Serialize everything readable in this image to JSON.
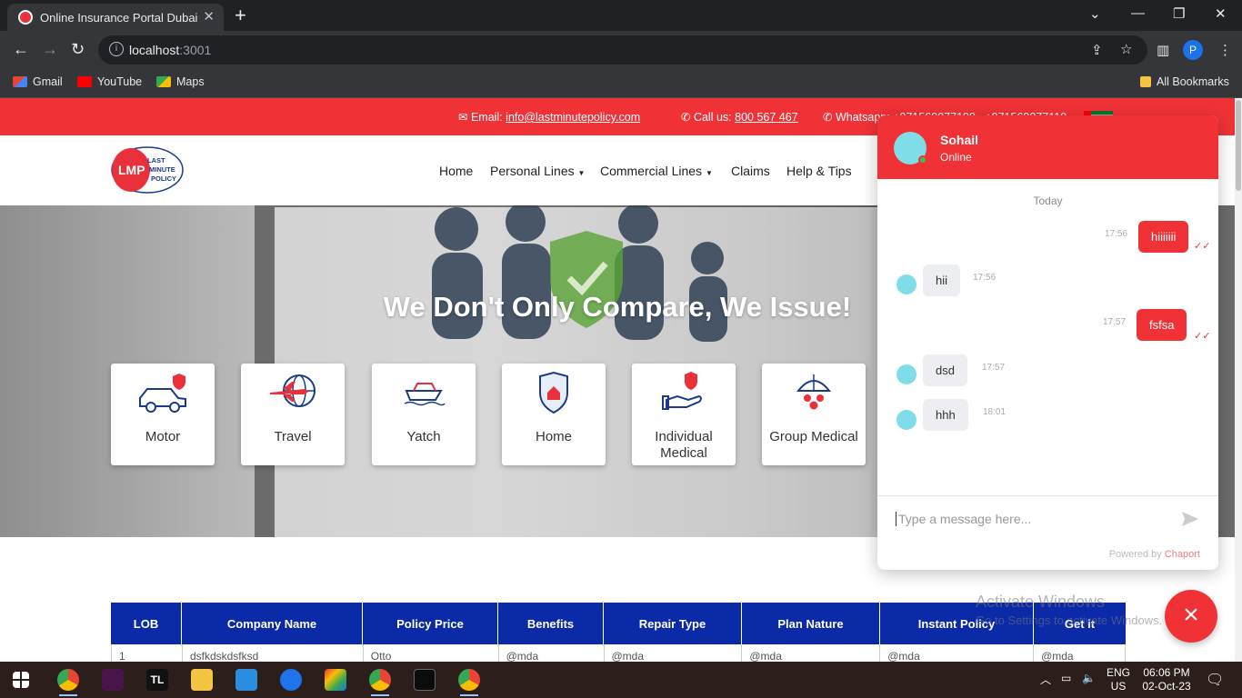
{
  "browser": {
    "tab_title": "Online Insurance Portal Dubai",
    "url_host": "localhost",
    "url_port": ":3001",
    "bookmarks": [
      "Gmail",
      "YouTube",
      "Maps"
    ],
    "all_bookmarks": "All Bookmarks",
    "profile_initial": "P"
  },
  "topstrip": {
    "email_label": "Email:",
    "email": "info@lastminutepolicy.com",
    "call_label": "Call us:",
    "phone": "800 567 467",
    "whatsapp_label": "Whatsapp:",
    "whatsapp_numbers": "+971569077199 , +971569077110"
  },
  "nav": {
    "logo_text": "LMP",
    "logo_words": [
      "LAST",
      "MINUTE",
      "POLICY"
    ],
    "items": [
      "Home",
      "Personal Lines",
      "Commercial Lines",
      "Claims",
      "Help & Tips"
    ]
  },
  "hero": {
    "heading": "We Don't Only Compare, We Issue!",
    "cards": [
      {
        "label": "Motor",
        "icon": "car-icon"
      },
      {
        "label": "Travel",
        "icon": "airplane-globe-icon"
      },
      {
        "label": "Yatch",
        "icon": "yacht-icon"
      },
      {
        "label": "Home",
        "icon": "house-shield-icon"
      },
      {
        "label": "Individual Medical",
        "icon": "hand-shield-icon"
      },
      {
        "label": "Group Medical",
        "icon": "umbrella-group-icon"
      }
    ]
  },
  "table": {
    "headers": [
      "LOB",
      "Company Name",
      "Policy Price",
      "Benefits",
      "Repair Type",
      "Plan Nature",
      "Instant Policy",
      "Get it"
    ],
    "first_row": [
      "1",
      "dsfkdskdsfksd",
      "Otto",
      "@mda",
      "@mda",
      "@mda",
      "@mda",
      "@mda"
    ]
  },
  "chat": {
    "agent_name": "Sohail",
    "agent_status": "Online",
    "day_label": "Today",
    "messages": [
      {
        "dir": "out",
        "text": "hiiiiiii",
        "time": "17:56"
      },
      {
        "dir": "in",
        "text": "hii",
        "time": "17:56"
      },
      {
        "dir": "out",
        "text": "fsfsa",
        "time": "17:57"
      },
      {
        "dir": "in",
        "text": "dsd",
        "time": "17:57"
      },
      {
        "dir": "in",
        "text": "hhh",
        "time": "18:01"
      }
    ],
    "input_placeholder": "Type a message here...",
    "powered_by": "Powered by",
    "powered_brand": "Chaport",
    "close_symbol": "×"
  },
  "watermark": {
    "line1": "Activate Windows",
    "line2": "Go to Settings to activate Windows."
  },
  "taskbar": {
    "lang1": "ENG",
    "lang2": "US",
    "time": "06:06 PM",
    "date": "02-Oct-23"
  },
  "colors": {
    "brand_red": "#f03237",
    "table_blue": "#0b2aa8",
    "icon_blue": "#1a3a8a"
  }
}
